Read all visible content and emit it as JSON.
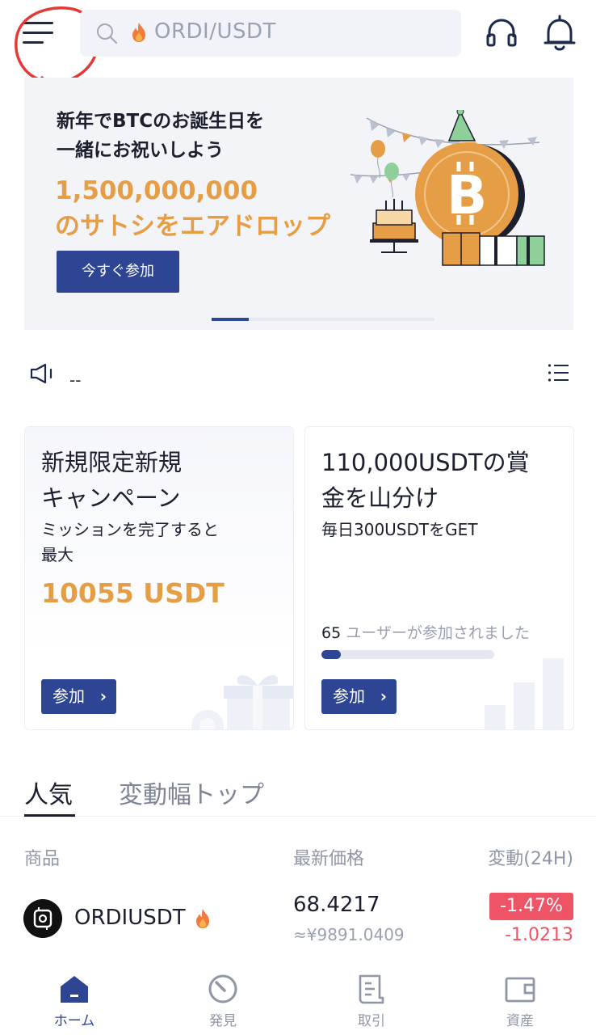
{
  "header": {
    "search_placeholder": "ORDI/USDT",
    "icons": [
      "menu-icon",
      "search-icon",
      "fire-icon",
      "headset-icon",
      "bell-icon"
    ]
  },
  "banner": {
    "title": "新年でBTCのお誕生日を\n一緒にお祝いしよう",
    "amount_line1": "1,500,000,000",
    "amount_line2": "のサトシをエアドロップ",
    "button_label": "今すぐ参加",
    "slide_count": 6,
    "active_slide": 1
  },
  "announcement": {
    "text": "--"
  },
  "cards": [
    {
      "title": "新規限定新規\nキャンペーン",
      "subtitle": "ミッションを完了すると\n最大",
      "highlight": "10055 USDT",
      "button_label": "参加"
    },
    {
      "title": "110,000USDTの賞\n金を山分け",
      "subtitle": "毎日300USDTをGET",
      "participants_count": "65",
      "participants_text": "ユーザーが参加されました",
      "progress_percent": 11,
      "button_label": "参加"
    }
  ],
  "tabs": [
    {
      "label": "人気",
      "active": true
    },
    {
      "label": "変動幅トップ",
      "active": false
    }
  ],
  "market": {
    "columns": [
      "商品",
      "最新価格",
      "変動(24H)"
    ],
    "rows": [
      {
        "symbol": "ORDIUSDT",
        "price": "68.4217",
        "price_fiat": "≈¥9891.0409",
        "change_pct": "-1.47%",
        "change_abs": "-1.0213"
      }
    ]
  },
  "bottom_nav": [
    {
      "label": "ホーム",
      "icon": "home-icon",
      "active": true
    },
    {
      "label": "発見",
      "icon": "compass-icon",
      "active": false
    },
    {
      "label": "取引",
      "icon": "trade-icon",
      "active": false
    },
    {
      "label": "資産",
      "icon": "wallet-icon",
      "active": false
    }
  ],
  "colors": {
    "primary": "#2d4593",
    "accent_orange": "#e69e46",
    "negative": "#ef5466",
    "annotation_red": "#e53935"
  }
}
